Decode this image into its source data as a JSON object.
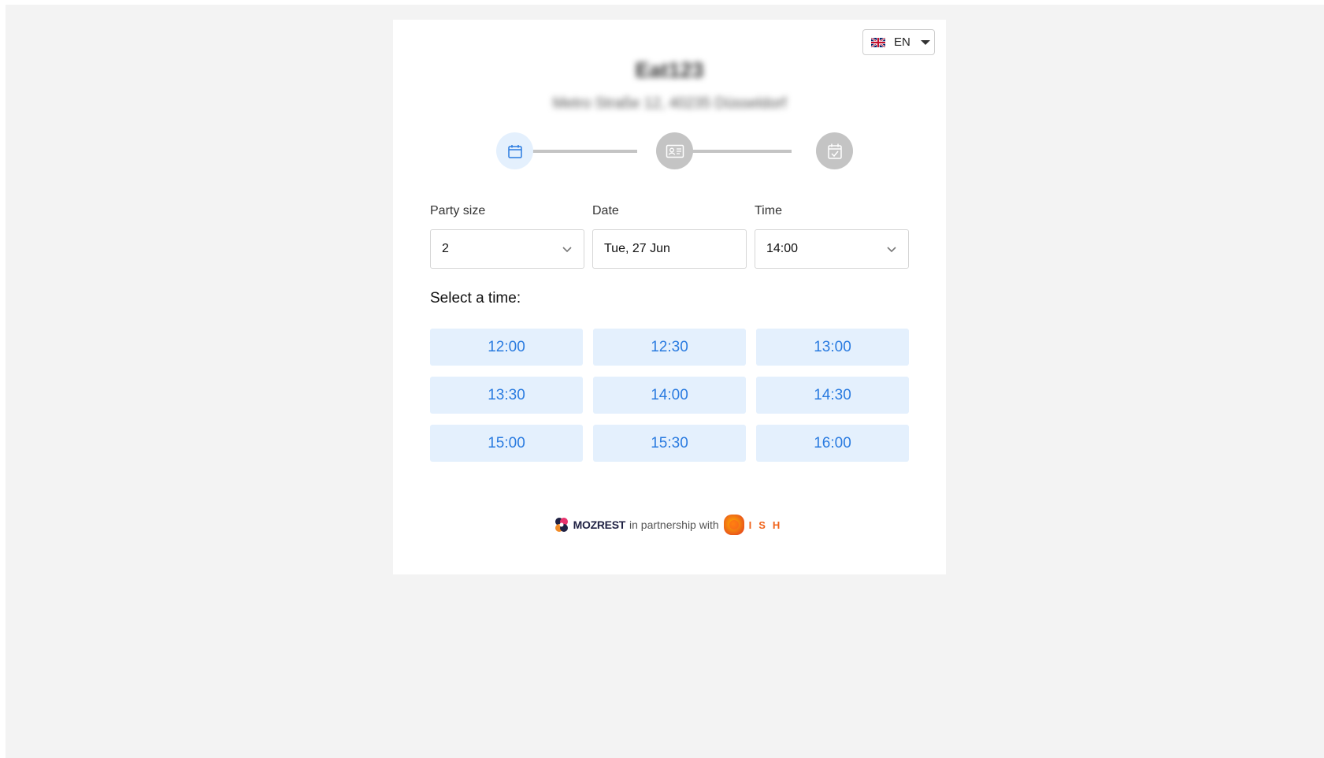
{
  "language": {
    "code": "EN",
    "flag": "uk-flag-icon"
  },
  "restaurant": {
    "name": "Eat123",
    "address": "Metro Straße 12, 40235 Düsseldorf"
  },
  "stepper": {
    "steps": [
      {
        "icon": "calendar-icon",
        "state": "active"
      },
      {
        "icon": "contact-card-icon",
        "state": "inactive"
      },
      {
        "icon": "calendar-check-icon",
        "state": "inactive"
      }
    ]
  },
  "form": {
    "party_size": {
      "label": "Party size",
      "value": "2"
    },
    "date": {
      "label": "Date",
      "value": "Tue, 27 Jun"
    },
    "time": {
      "label": "Time",
      "value": "14:00"
    }
  },
  "slots": {
    "title": "Select a time:",
    "times": [
      "12:00",
      "12:30",
      "13:00",
      "13:30",
      "14:00",
      "14:30",
      "15:00",
      "15:30",
      "16:00"
    ]
  },
  "footer": {
    "brand": "MOZREST",
    "partnership_text": "in partnership with",
    "partner": "ISH"
  },
  "colors": {
    "accent": "#2a7be0",
    "slot_bg": "#e4f0fd",
    "inactive_step": "#c4c4c4",
    "page_bg": "#f3f3f3",
    "partner_orange": "#f0631a"
  }
}
